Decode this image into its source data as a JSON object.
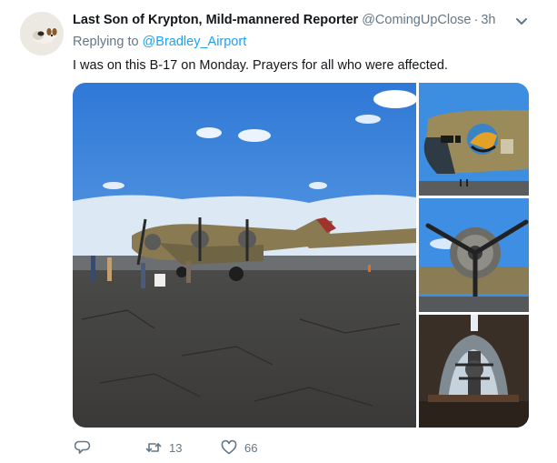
{
  "tweet": {
    "author": {
      "display_name": "Last Son of Krypton, Mild-mannered Reporter",
      "handle": "@ComingUpClose",
      "avatar_icon": "dog-avatar"
    },
    "separator": "·",
    "timestamp": "3h",
    "replying_prefix": "Replying to",
    "replying_to": "@Bradley_Airport",
    "text": "I was on this B-17 on Monday. Prayers for all who were affected.",
    "media": [
      {
        "name": "b17-ground-view-photo"
      },
      {
        "name": "b17-nose-art-photo"
      },
      {
        "name": "b17-engine-propeller-photo"
      },
      {
        "name": "b17-turret-interior-photo"
      }
    ],
    "actions": {
      "reply_icon": "reply-icon",
      "retweet_icon": "retweet-icon",
      "retweet_count": "13",
      "like_icon": "heart-icon",
      "like_count": "66",
      "menu_icon": "chevron-down-icon"
    },
    "colors": {
      "link": "#1da1f2",
      "secondary_text": "#657786",
      "primary_text": "#14171a"
    }
  }
}
